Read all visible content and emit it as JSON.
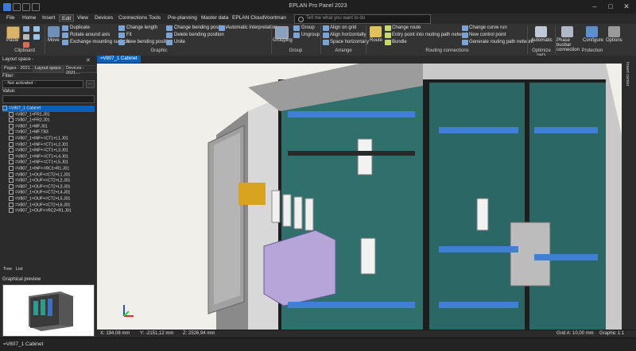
{
  "titlebar": {
    "title": "EPLAN Pro Panel 2023"
  },
  "menu": [
    {
      "label": "File"
    },
    {
      "label": "Home"
    },
    {
      "label": "Insert"
    },
    {
      "label": "Edit",
      "active": true
    },
    {
      "label": "View"
    },
    {
      "label": "Devices"
    },
    {
      "label": "Connections"
    },
    {
      "label": "Tools"
    },
    {
      "label": "Pre-planning"
    },
    {
      "label": "Master data"
    },
    {
      "label": "EPLAN Cloud"
    },
    {
      "label": "Voortman"
    }
  ],
  "search": {
    "placeholder": "Tell me what you want to do"
  },
  "ribbon": {
    "clipboard": {
      "paste": "Paste",
      "group": "Clipboard"
    },
    "graphic": {
      "move": "Move",
      "duplicate": "Duplicate",
      "rotate": "Rotate around axis",
      "exchange": "Exchange mounting surface",
      "change_length": "Change length",
      "fit": "Fit",
      "new_bending": "New bending position",
      "change_bending": "Change bending position",
      "delete_bending": "Delete bending position",
      "unite": "Unite",
      "auto_interp": "Automatic interpretation",
      "group": "Graphic"
    },
    "group_grp": {
      "grouping": "Grouping",
      "group_btn": "Group",
      "ungroup": "Ungroup",
      "group": "Group"
    },
    "arrange": {
      "align_grid": "Align on grid",
      "align_h": "Align horizontally",
      "space_h": "Space horizontally",
      "group": "Arrange"
    },
    "routing": {
      "route": "Route",
      "change_route": "Change route",
      "entry_point": "Entry point into routing path network",
      "bundle": "Bundle",
      "change_curve": "Change curve run",
      "new_control": "New control point",
      "generate": "Generate routing path network",
      "group": "Routing connections"
    },
    "optimize": {
      "automatic": "Automatic",
      "group": "Optimize nets"
    },
    "protection": {
      "phase_busbar": "Phase busbar connection",
      "configure": "Configure",
      "options": "Options",
      "group": "Protection"
    }
  },
  "leftpanel": {
    "layout_title": "Layout space -",
    "tabs": [
      {
        "label": "Pages - 2021…"
      },
      {
        "label": "Layout space …",
        "active": true
      },
      {
        "label": "Devices - 2021…"
      }
    ],
    "filter_label": "Filter:",
    "filter_value": "- Not activated -",
    "value_label": "Value:",
    "tree": [
      {
        "label": "=V807_1 Cabinet",
        "sel": true
      },
      {
        "label": "=V807_1+FR1.J01"
      },
      {
        "label": "=V807_1+FR2.J01"
      },
      {
        "label": "=V807_1+MF.J01"
      },
      {
        "label": "=V807_1+MF.TB3"
      },
      {
        "label": "=V807_1+INF+=CT1+L1.J01"
      },
      {
        "label": "=V807_1+INF+=CT1+L2.J01"
      },
      {
        "label": "=V807_1+INF+=CT1+L3.J01"
      },
      {
        "label": "=V807_1+INF+=CT1+L4.J01"
      },
      {
        "label": "=V807_1+INF+=CT1+L5.J01"
      },
      {
        "label": "=V807_1+INF+=RC1+R1.J01"
      },
      {
        "label": "=V807_1+OUF+=CT2+L1.J01"
      },
      {
        "label": "=V807_1+OUF+=CT2+L2.J01"
      },
      {
        "label": "=V807_1+OUF+=CT2+L3.J01"
      },
      {
        "label": "=V807_1+OUF+=CT2+L4.J01"
      },
      {
        "label": "=V807_1+OUF+=CT2+L5.J01"
      },
      {
        "label": "=V807_1+OUF+=CT2+L6.J01"
      },
      {
        "label": "=V807_1+OUF+=RC2+R1.J01"
      }
    ],
    "bottom_tabs": [
      {
        "label": "Tree"
      },
      {
        "label": "List"
      }
    ],
    "preview_title": "Graphical preview"
  },
  "document_tab": "=V807_1 Cabinet",
  "right_strip": "Insert center",
  "status": {
    "x": "X: 194,08 mm",
    "y": "Y: -2151,12 mm",
    "z": "Z: 2526,94 mm",
    "grid": "Grid A: 10,00 mm",
    "graphic": "Graphic 1:1"
  },
  "bottombar": {
    "label": "=V807_1 Cabinet"
  }
}
